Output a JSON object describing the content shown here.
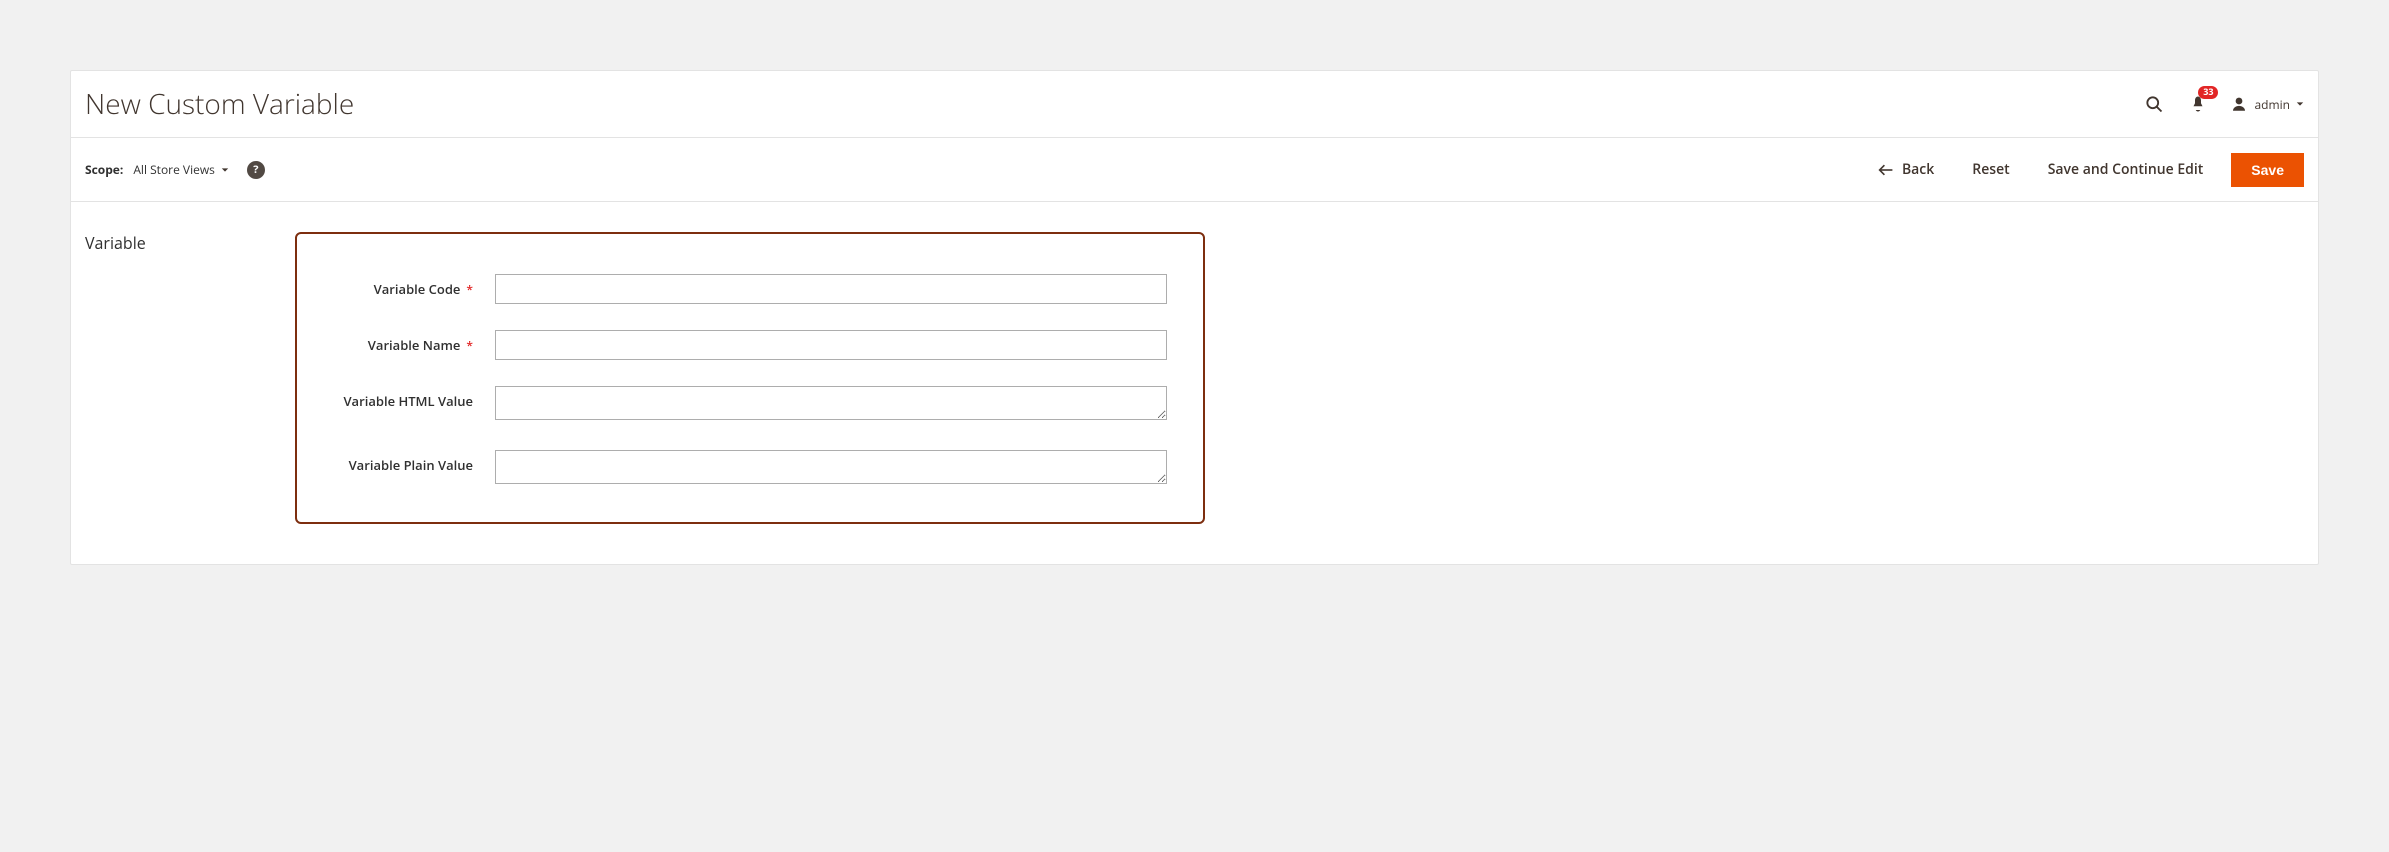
{
  "header": {
    "title": "New Custom Variable",
    "user_name": "admin",
    "notifications_count": "33"
  },
  "toolbar": {
    "scope_label": "Scope:",
    "scope_value": "All Store Views",
    "help_glyph": "?",
    "back_label": "Back",
    "reset_label": "Reset",
    "save_continue_label": "Save and Continue Edit",
    "save_label": "Save"
  },
  "section": {
    "title": "Variable"
  },
  "form": {
    "variable_code": {
      "label": "Variable Code",
      "value": "",
      "required": true
    },
    "variable_name": {
      "label": "Variable Name",
      "value": "",
      "required": true
    },
    "variable_html_value": {
      "label": "Variable HTML Value",
      "value": ""
    },
    "variable_plain_value": {
      "label": "Variable Plain Value",
      "value": ""
    }
  }
}
